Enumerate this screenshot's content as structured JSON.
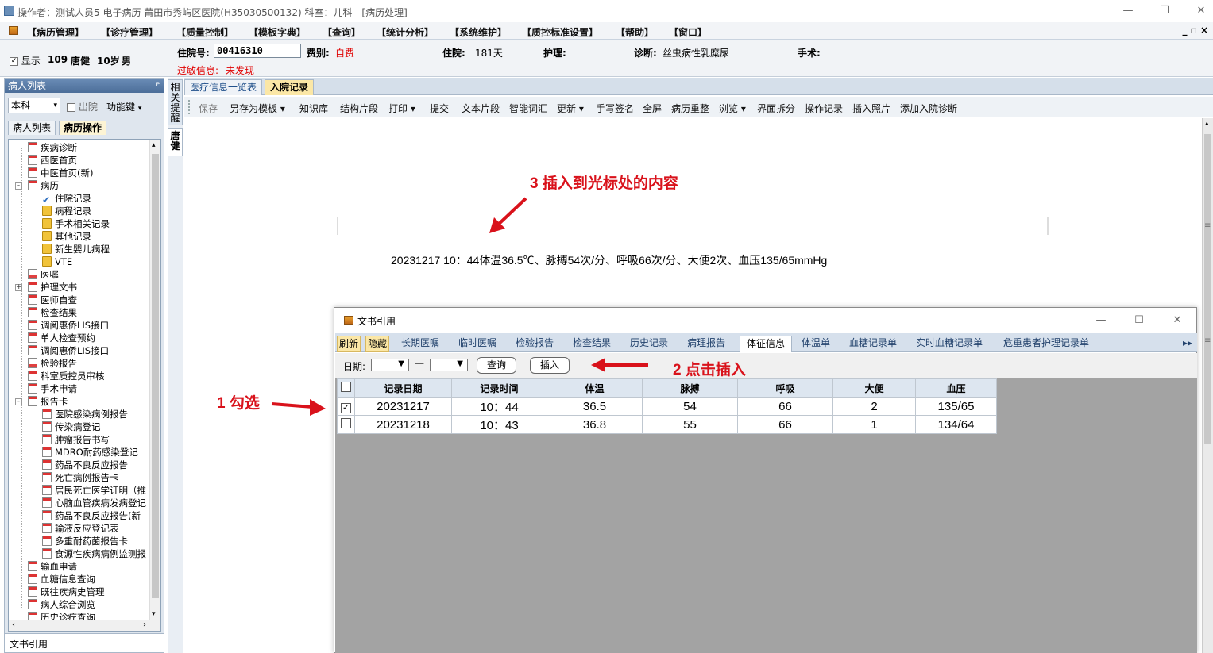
{
  "window": {
    "title": "操作者：测试人员5 电子病历  莆田市秀屿区医院(H35030500132)  科室：儿科 - [病历处理]",
    "minimize": "—",
    "maximize": "❐",
    "close": "✕"
  },
  "menu": {
    "items": [
      "【病历管理】",
      "【诊疗管理】",
      "【质量控制】",
      "【模板字典】",
      "【查询】",
      "【统计分析】",
      "【系统维护】",
      "【质控标准设置】",
      "【帮助】",
      "【窗口】"
    ],
    "mdi_controls": "_ ▫ ×"
  },
  "patient": {
    "show_label": "显示",
    "show_checked": true,
    "bed": "109",
    "name": "唐健",
    "age": "10岁",
    "sex": "男",
    "admission_no_label": "住院号:",
    "admission_no": "00416310",
    "fee_type_label": "费别:",
    "fee_type": "自费",
    "stay_label": "住院:",
    "stay_days": "181天",
    "nursing_label": "护理:",
    "nursing_value": "",
    "diagnosis_label": "诊断:",
    "diagnosis": "丝虫病性乳糜尿",
    "surgery_label": "手术:",
    "surgery_value": "",
    "allergy_label": "过敏信息:",
    "allergy_value": "未发现"
  },
  "left_panel": {
    "header": "病人列表",
    "pin": "ᴾ",
    "dept_select": "本科",
    "discharged_label": "出院",
    "function_key": "功能键",
    "tabs": [
      "病人列表",
      "病历操作"
    ],
    "active_tab": 1,
    "footer": "文书引用",
    "tree": [
      {
        "label": "疾病诊断",
        "icon": "doc-icon",
        "level": 1
      },
      {
        "label": "西医首页",
        "icon": "doc-icon",
        "level": 1
      },
      {
        "label": "中医首页(新)",
        "icon": "doc-icon",
        "level": 1
      },
      {
        "label": "病历",
        "icon": "doc-icon",
        "level": 1,
        "expand": "-"
      },
      {
        "label": "住院记录",
        "icon": "check-icon",
        "level": 2
      },
      {
        "label": "病程记录",
        "icon": "folder-icon",
        "level": 2
      },
      {
        "label": "手术相关记录",
        "icon": "folder-icon",
        "level": 2
      },
      {
        "label": "其他记录",
        "icon": "folder-icon",
        "level": 2
      },
      {
        "label": "新生婴儿病程",
        "icon": "folder-icon",
        "level": 2
      },
      {
        "label": "VTE",
        "icon": "folder-icon",
        "level": 2
      },
      {
        "label": "医嘱",
        "icon": "rx-icon",
        "level": 1
      },
      {
        "label": "护理文书",
        "icon": "doc-icon",
        "level": 1,
        "expand": "+"
      },
      {
        "label": "医师自查",
        "icon": "doc-icon",
        "level": 1
      },
      {
        "label": "检查结果",
        "icon": "doc-icon",
        "level": 1
      },
      {
        "label": "调阅惠侨LIS接口",
        "icon": "doc-icon",
        "level": 1
      },
      {
        "label": "单人检查预约",
        "icon": "doc-icon",
        "level": 1
      },
      {
        "label": "调阅惠侨LIS接口",
        "icon": "doc-icon",
        "level": 1
      },
      {
        "label": "检验报告",
        "icon": "rx-icon",
        "level": 1
      },
      {
        "label": "科室质控员审核",
        "icon": "doc-icon",
        "level": 1
      },
      {
        "label": "手术申请",
        "icon": "doc-icon",
        "level": 1
      },
      {
        "label": "报告卡",
        "icon": "doc-icon",
        "level": 1,
        "expand": "-"
      },
      {
        "label": "医院感染病例报告",
        "icon": "doc-icon",
        "level": 2
      },
      {
        "label": "传染病登记",
        "icon": "doc-icon",
        "level": 2
      },
      {
        "label": "肿瘤报告书写",
        "icon": "doc-icon",
        "level": 2
      },
      {
        "label": "MDRO耐药感染登记",
        "icon": "doc-icon",
        "level": 2
      },
      {
        "label": "药品不良反应报告",
        "icon": "doc-icon",
        "level": 2
      },
      {
        "label": "死亡病例报告卡",
        "icon": "doc-icon",
        "level": 2
      },
      {
        "label": "居民死亡医学证明（推",
        "icon": "doc-icon",
        "level": 2
      },
      {
        "label": "心脑血管疾病发病登记",
        "icon": "doc-icon",
        "level": 2
      },
      {
        "label": "药品不良反应报告(新",
        "icon": "doc-icon",
        "level": 2
      },
      {
        "label": "输液反应登记表",
        "icon": "doc-icon",
        "level": 2
      },
      {
        "label": "多重耐药菌报告卡",
        "icon": "doc-icon",
        "level": 2
      },
      {
        "label": "食源性疾病病例监测报",
        "icon": "doc-icon",
        "level": 2
      },
      {
        "label": "输血申请",
        "icon": "doc-icon",
        "level": 1
      },
      {
        "label": "血糖信息查询",
        "icon": "doc-icon",
        "level": 1
      },
      {
        "label": "既往疾病史管理",
        "icon": "doc-icon",
        "level": 1
      },
      {
        "label": "病人综合浏览",
        "icon": "doc-icon",
        "level": 1
      },
      {
        "label": "历史诊疗查询",
        "icon": "doc-icon",
        "level": 1
      }
    ]
  },
  "side_strip": {
    "tab1": "相关提醒",
    "tab2": "唐健"
  },
  "doc_tabs": [
    "医疗信息一览表",
    "入院记录"
  ],
  "doc_active_tab": 1,
  "doc_toolbar": [
    "保存",
    "另存为模板 ▾",
    "知识库",
    "结构片段",
    "打印 ▾",
    "提交",
    "文本片段",
    "智能词汇",
    "更新 ▾",
    "手写签名",
    "全屏",
    "病历重整",
    "浏览 ▾",
    "界面拆分",
    "操作记录",
    "插入照片",
    "添加入院诊断"
  ],
  "document": {
    "inserted_text": "20231217  10：44体温36.5℃、脉搏54次/分、呼吸66次/分、大便2次、血压135/65mmHg"
  },
  "annotations": {
    "step1": "1 勾选",
    "step2": "2 点击插入",
    "step3": "3 插入到光标处的内容",
    "color": "#d9121b"
  },
  "dialog": {
    "title": "文书引用",
    "minimize": "—",
    "maximize": "☐",
    "close": "✕",
    "tabs": [
      "刷新",
      "隐藏",
      "长期医嘱",
      "临时医嘱",
      "检验报告",
      "检查结果",
      "历史记录",
      "病理报告",
      "体征信息",
      "体温单",
      "血糖记录单",
      "实时血糖记录单",
      "危重患者护理记录单"
    ],
    "active_tab": "体征信息",
    "more": "▸▸",
    "date_label": "日期:",
    "date_sep": "—",
    "query_button": "查询",
    "insert_button": "插入",
    "columns": [
      "记录日期",
      "记录时间",
      "体温",
      "脉搏",
      "呼吸",
      "大便",
      "血压"
    ],
    "rows": [
      {
        "checked": true,
        "cells": [
          "20231217",
          "10：44",
          "36.5",
          "54",
          "66",
          "2",
          "135/65"
        ]
      },
      {
        "checked": false,
        "cells": [
          "20231218",
          "10：43",
          "36.8",
          "55",
          "66",
          "1",
          "134/64"
        ]
      }
    ]
  }
}
